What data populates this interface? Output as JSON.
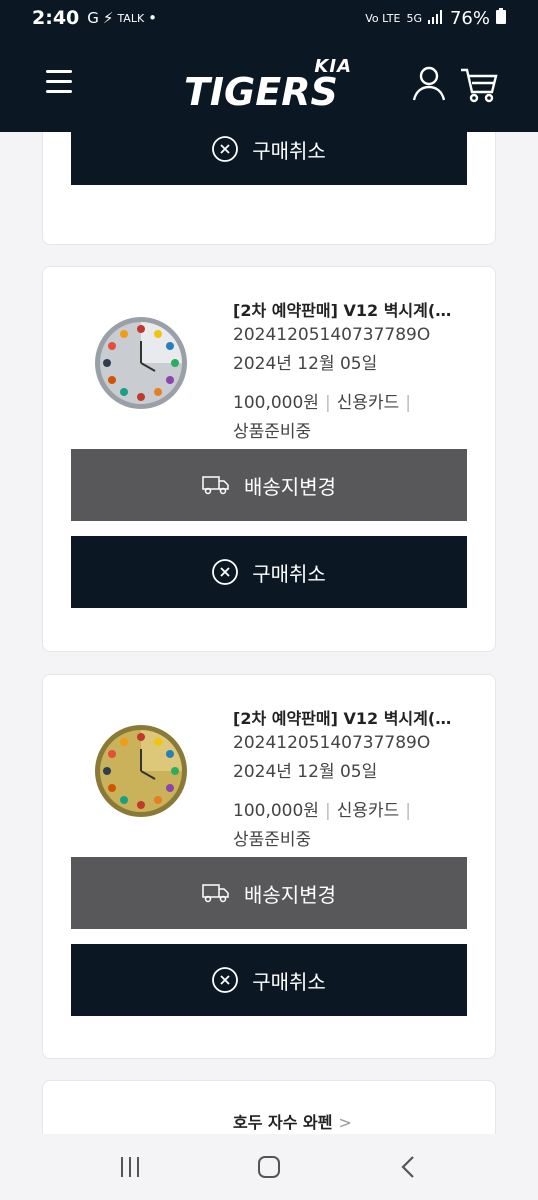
{
  "status_bar": {
    "time": "2:40",
    "indicators": [
      "G",
      "⚡",
      "TALK",
      "•"
    ],
    "network_label": "Vo LTE",
    "signal_label": "5G",
    "battery": "76%"
  },
  "header": {
    "brand_small": "KIA",
    "brand_title": "TIGERS"
  },
  "orders": [
    {
      "cancel_label": "구매취소"
    },
    {
      "title": "[2차 예약판매] V12 벽시계(…",
      "order_no": "20241205140737789O",
      "date": "2024년 12월 05일",
      "price": "100,000원",
      "payment": "신용카드",
      "status": "상품준비중",
      "change_address_label": "배송지변경",
      "cancel_label": "구매취소",
      "clock_face": "silver"
    },
    {
      "title": "[2차 예약판매] V12 벽시계(…",
      "order_no": "20241205140737789O",
      "date": "2024년 12월 05일",
      "price": "100,000원",
      "payment": "신용카드",
      "status": "상품준비중",
      "change_address_label": "배송지변경",
      "cancel_label": "구매취소",
      "clock_face": "gold"
    },
    {
      "title": "호두 자수 와펜"
    }
  ],
  "colors": {
    "header_bg": "#0b1824",
    "button_gray": "#58585a",
    "clock_silver": "#c9ccd1",
    "clock_gold": "#c9b25a"
  },
  "icons": {
    "menu": "hamburger-icon",
    "user": "user-icon",
    "cart": "cart-icon",
    "cancel": "x-circle-icon",
    "truck": "truck-icon",
    "recent": "recent-apps-icon",
    "home": "home-icon",
    "back": "back-icon"
  }
}
